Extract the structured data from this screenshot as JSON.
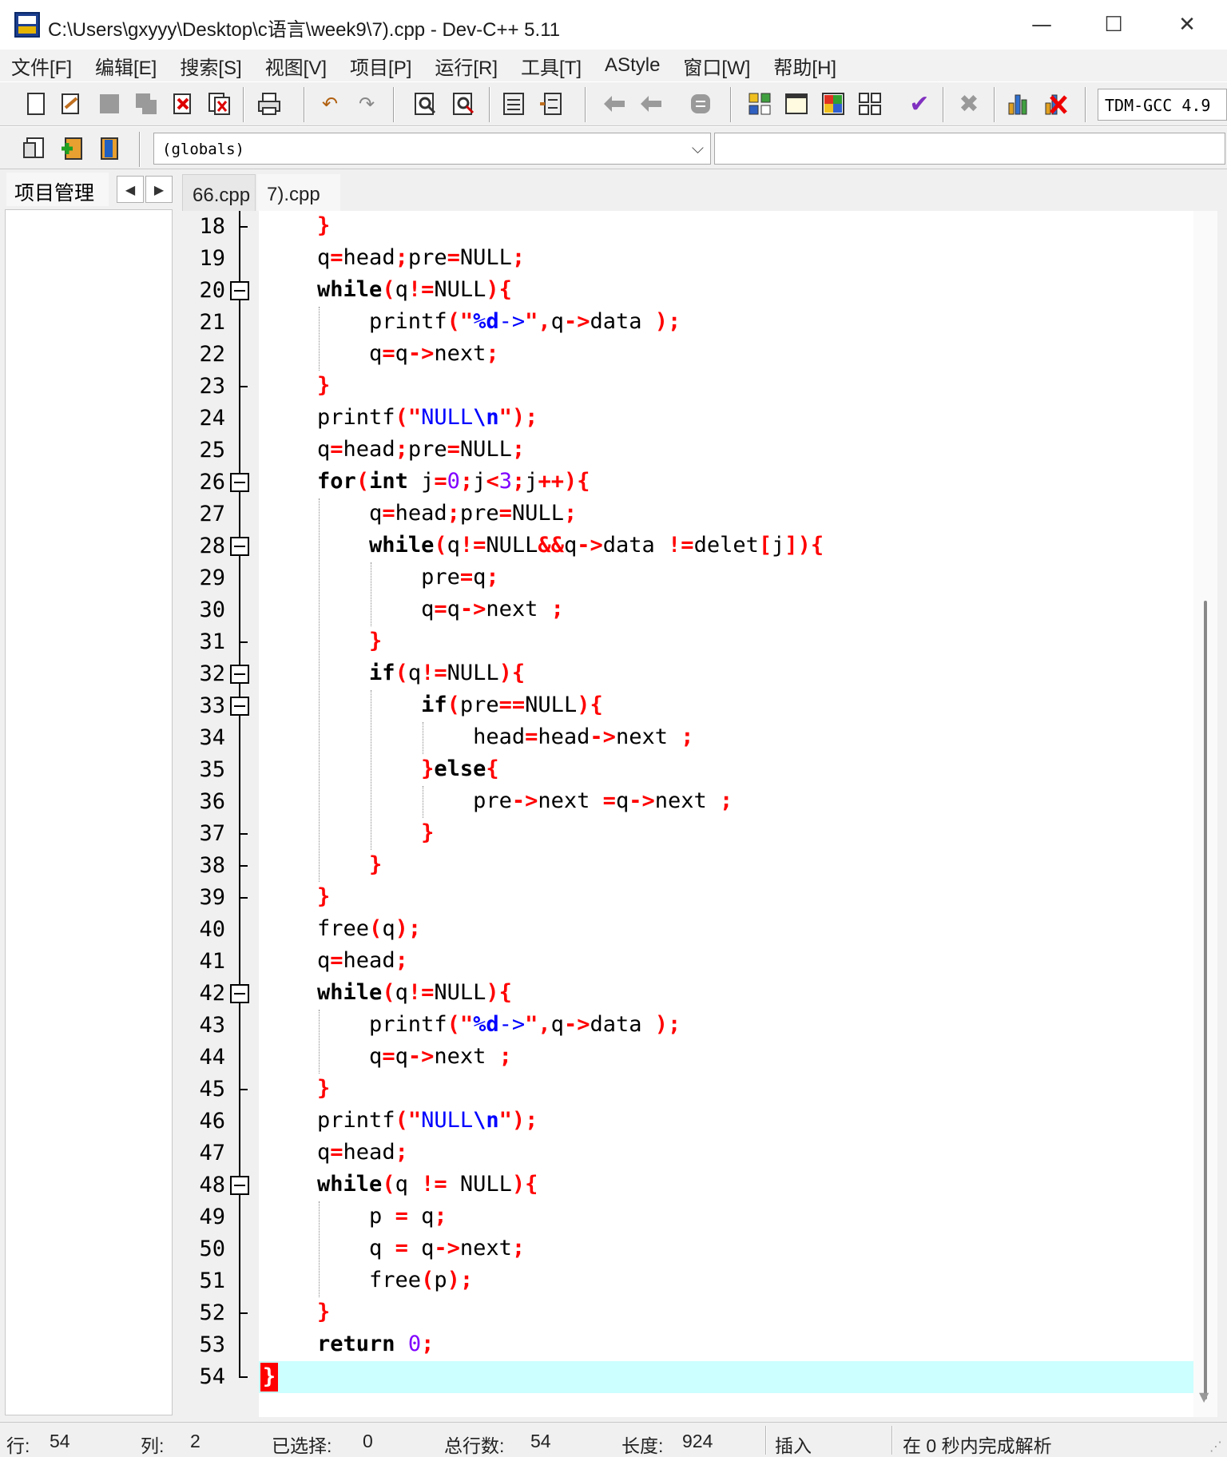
{
  "window": {
    "title": "C:\\Users\\gxyyy\\Desktop\\c语言\\week9\\7).cpp - Dev-C++ 5.11",
    "minimize": "—",
    "maximize": "☐",
    "close": "✕"
  },
  "menu": [
    "文件[F]",
    "编辑[E]",
    "搜索[S]",
    "视图[V]",
    "项目[P]",
    "运行[R]",
    "工具[T]",
    "AStyle",
    "窗口[W]",
    "帮助[H]"
  ],
  "toolbar": {
    "compiler": "TDM-GCC 4.9",
    "globals": "(globals)",
    "dropdown_arrow": "⌵"
  },
  "left_panel": {
    "tab": "项目管理",
    "prev": "◀",
    "next": "▶"
  },
  "editor_tabs": [
    "66.cpp",
    "7).cpp"
  ],
  "code": [
    {
      "n": "18",
      "text": "    }"
    },
    {
      "n": "19",
      "text": "    q=head;pre=NULL;"
    },
    {
      "n": "20",
      "text": "    while(q!=NULL){"
    },
    {
      "n": "21",
      "text": "        printf(\"%d->\",q->data );"
    },
    {
      "n": "22",
      "text": "        q=q->next;"
    },
    {
      "n": "23",
      "text": "    }"
    },
    {
      "n": "24",
      "text": "    printf(\"NULL\\n\");"
    },
    {
      "n": "25",
      "text": "    q=head;pre=NULL;"
    },
    {
      "n": "26",
      "text": "    for(int j=0;j<3;j++){"
    },
    {
      "n": "27",
      "text": "        q=head;pre=NULL;"
    },
    {
      "n": "28",
      "text": "        while(q!=NULL&&q->data !=delet[j]){"
    },
    {
      "n": "29",
      "text": "            pre=q;"
    },
    {
      "n": "30",
      "text": "            q=q->next ;"
    },
    {
      "n": "31",
      "text": "        }"
    },
    {
      "n": "32",
      "text": "        if(q!=NULL){"
    },
    {
      "n": "33",
      "text": "            if(pre==NULL){"
    },
    {
      "n": "34",
      "text": "                head=head->next ;"
    },
    {
      "n": "35",
      "text": "            }else{"
    },
    {
      "n": "36",
      "text": "                pre->next =q->next ;"
    },
    {
      "n": "37",
      "text": "            }"
    },
    {
      "n": "38",
      "text": "        }"
    },
    {
      "n": "39",
      "text": "    }"
    },
    {
      "n": "40",
      "text": "    free(q);"
    },
    {
      "n": "41",
      "text": "    q=head;"
    },
    {
      "n": "42",
      "text": "    while(q!=NULL){"
    },
    {
      "n": "43",
      "text": "        printf(\"%d->\",q->data );"
    },
    {
      "n": "44",
      "text": "        q=q->next ;"
    },
    {
      "n": "45",
      "text": "    }"
    },
    {
      "n": "46",
      "text": "    printf(\"NULL\\n\");"
    },
    {
      "n": "47",
      "text": "    q=head;"
    },
    {
      "n": "48",
      "text": "    while(q != NULL){"
    },
    {
      "n": "49",
      "text": "        p = q;"
    },
    {
      "n": "50",
      "text": "        q = q->next;"
    },
    {
      "n": "51",
      "text": "        free(p);"
    },
    {
      "n": "52",
      "text": "    }"
    },
    {
      "n": "53",
      "text": "    return 0;"
    },
    {
      "n": "54",
      "text": "}"
    }
  ],
  "status": {
    "row_label": "行:",
    "row": "54",
    "col_label": "列:",
    "col": "2",
    "sel_label": "已选择:",
    "sel": "0",
    "lines_label": "总行数:",
    "lines": "54",
    "len_label": "长度:",
    "len": "924",
    "mode": "插入",
    "parse": "在 0 秒内完成解析"
  },
  "colors": {
    "symbol": "#ff0000",
    "string": "#0000ff",
    "number": "#8000ff",
    "current_line": "#ccffff"
  }
}
